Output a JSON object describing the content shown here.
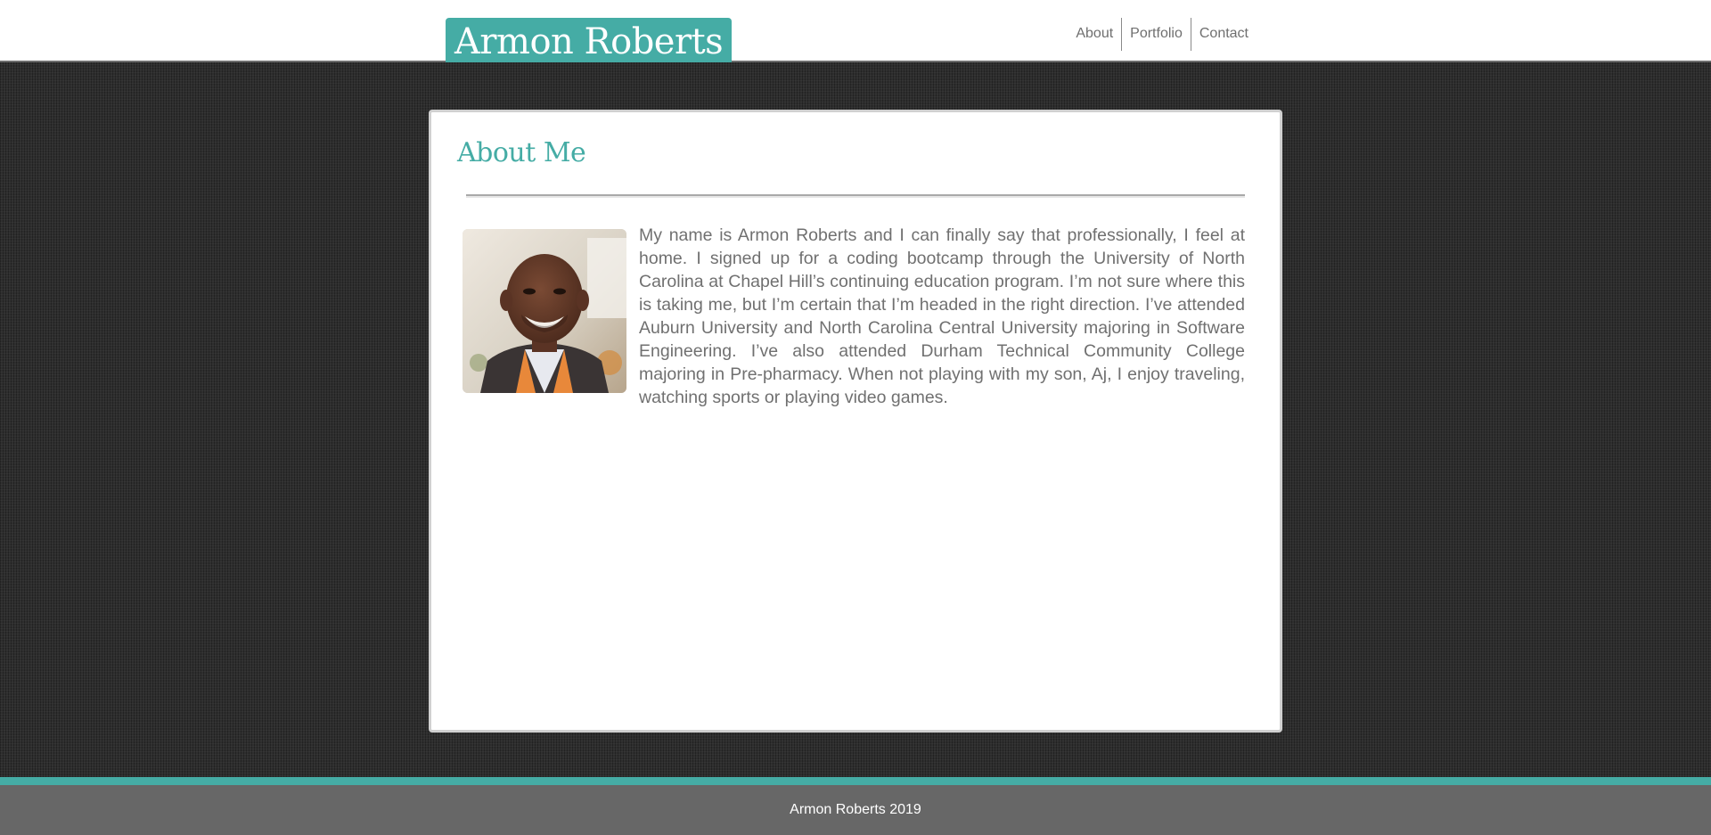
{
  "header": {
    "logo_text": "Armon Roberts",
    "nav": [
      {
        "label": "About"
      },
      {
        "label": "Portfolio"
      },
      {
        "label": "Contact"
      }
    ]
  },
  "main": {
    "section_title": "About Me",
    "photo_alt": "profile-photo",
    "bio": "My name is Armon Roberts and I can finally say that professionally, I feel at home. I signed up for a coding bootcamp through the University of North Carolina at Chapel Hill’s continuing education program. I’m not sure where this is taking me, but I’m certain that I’m headed in the right direction. I’ve attended Auburn University and North Carolina Central University majoring in Software Engineering. I’ve also attended Durham Technical Community College majoring in Pre-pharmacy. When not playing with my son, Aj, I enjoy traveling, watching sports or playing video games."
  },
  "footer": {
    "text": "Armon Roberts 2019"
  },
  "colors": {
    "accent": "#45aca5",
    "background": "#2e2e2e",
    "footer": "#676767",
    "text": "#707070"
  }
}
